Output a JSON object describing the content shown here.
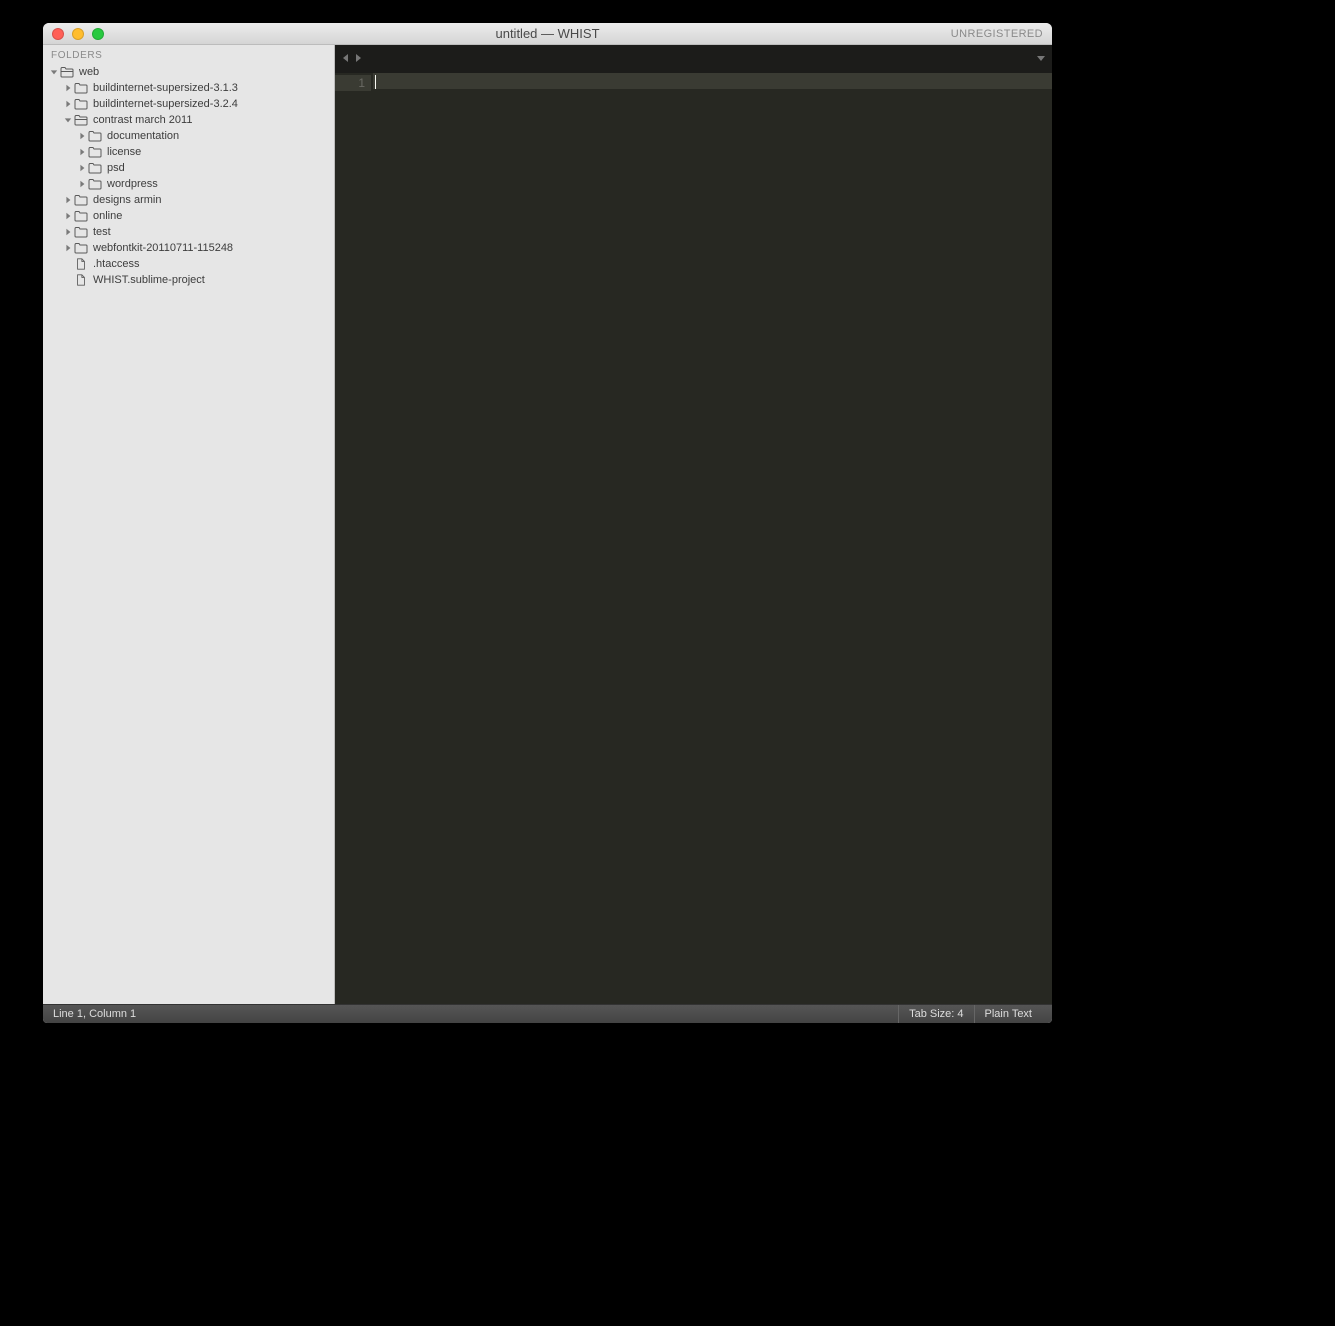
{
  "window": {
    "title": "untitled — WHIST",
    "unregistered": "UNREGISTERED"
  },
  "sidebar": {
    "header": "FOLDERS",
    "tree": [
      {
        "depth": 0,
        "expanded": true,
        "kind": "folder-open",
        "label": "web"
      },
      {
        "depth": 1,
        "expanded": false,
        "kind": "folder",
        "label": "buildinternet-supersized-3.1.3"
      },
      {
        "depth": 1,
        "expanded": false,
        "kind": "folder",
        "label": "buildinternet-supersized-3.2.4"
      },
      {
        "depth": 1,
        "expanded": true,
        "kind": "folder-open",
        "label": "contrast march 2011"
      },
      {
        "depth": 2,
        "expanded": false,
        "kind": "folder",
        "label": "documentation"
      },
      {
        "depth": 2,
        "expanded": false,
        "kind": "folder",
        "label": "license"
      },
      {
        "depth": 2,
        "expanded": false,
        "kind": "folder",
        "label": "psd"
      },
      {
        "depth": 2,
        "expanded": false,
        "kind": "folder",
        "label": "wordpress"
      },
      {
        "depth": 1,
        "expanded": false,
        "kind": "folder",
        "label": "designs armin"
      },
      {
        "depth": 1,
        "expanded": false,
        "kind": "folder",
        "label": "online"
      },
      {
        "depth": 1,
        "expanded": false,
        "kind": "folder",
        "label": "test"
      },
      {
        "depth": 1,
        "expanded": false,
        "kind": "folder",
        "label": "webfontkit-20110711-115248"
      },
      {
        "depth": 1,
        "expanded": null,
        "kind": "file",
        "label": ".htaccess"
      },
      {
        "depth": 1,
        "expanded": null,
        "kind": "file",
        "label": "WHIST.sublime-project"
      }
    ]
  },
  "editor": {
    "gutter_lines": [
      "1"
    ]
  },
  "statusbar": {
    "position": "Line 1, Column 1",
    "tab_size": "Tab Size: 4",
    "syntax": "Plain Text"
  }
}
